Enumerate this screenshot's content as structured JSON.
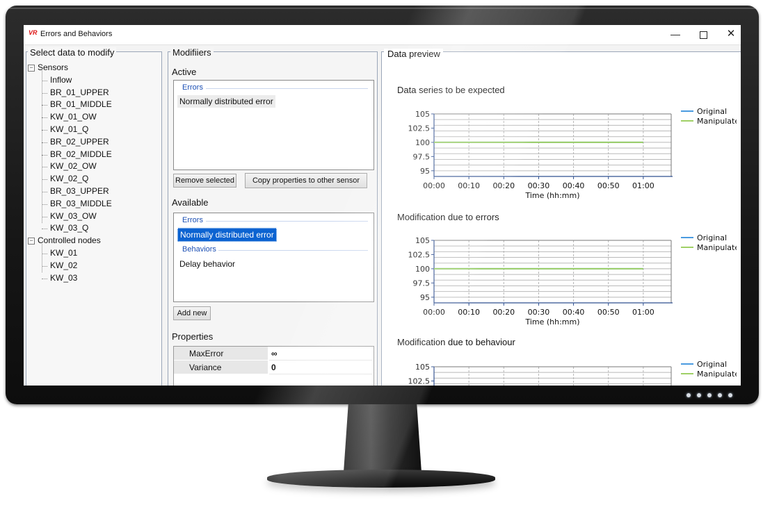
{
  "window": {
    "logo": "VR",
    "title": "Errors and Behaviors",
    "minimize_glyph": "—",
    "close_glyph": "✕"
  },
  "tree": {
    "title": "Select data to modify",
    "groups": [
      {
        "label": "Sensors",
        "expander": "−",
        "items": [
          "Inflow",
          "BR_01_UPPER",
          "BR_01_MIDDLE",
          "KW_01_OW",
          "KW_01_Q",
          "BR_02_UPPER",
          "BR_02_MIDDLE",
          "KW_02_OW",
          "KW_02_Q",
          "BR_03_UPPER",
          "BR_03_MIDDLE",
          "KW_03_OW",
          "KW_03_Q"
        ]
      },
      {
        "label": "Controlled nodes",
        "expander": "−",
        "items": [
          "KW_01",
          "KW_02",
          "KW_03"
        ]
      }
    ]
  },
  "modifiers": {
    "title": "Modifiiers",
    "active": {
      "heading": "Active",
      "errors_head": "Errors",
      "errors_items": [
        "Normally distributed error"
      ]
    },
    "remove_button": "Remove selected",
    "copy_button": "Copy properties to other sensor",
    "available": {
      "heading": "Available",
      "errors_head": "Errors",
      "errors_items": [
        "Normally distributed error"
      ],
      "behaviors_head": "Behaviors",
      "behaviors_items": [
        "Delay behavior"
      ]
    },
    "add_button": "Add new",
    "properties": {
      "heading": "Properties",
      "rows": [
        {
          "name": "MaxError",
          "value": "∞"
        },
        {
          "name": "Variance",
          "value": "0"
        }
      ]
    }
  },
  "preview": {
    "title": "Data preview"
  },
  "chart_data": [
    {
      "type": "line",
      "title": "Data series to be expected",
      "xlabel": "Time (hh:mm)",
      "ylabel": "",
      "x_ticks": [
        "00:00",
        "00:10",
        "00:20",
        "00:30",
        "00:40",
        "00:50",
        "01:00"
      ],
      "y_ticks": [
        "105",
        "102.5",
        "100",
        "97.5",
        "95"
      ],
      "xlim": [
        0,
        68
      ],
      "ylim": [
        94,
        105
      ],
      "grid": true,
      "legend": "right",
      "series": [
        {
          "name": "Original",
          "color": "#4a9be0",
          "x": [
            0,
            60
          ],
          "y": [
            100,
            100
          ]
        },
        {
          "name": "Manipulated",
          "color": "#9fd066",
          "x": [
            0,
            60
          ],
          "y": [
            100,
            100
          ]
        }
      ]
    },
    {
      "type": "line",
      "title": "Modification due to errors",
      "xlabel": "Time (hh:mm)",
      "ylabel": "",
      "x_ticks": [
        "00:00",
        "00:10",
        "00:20",
        "00:30",
        "00:40",
        "00:50",
        "01:00"
      ],
      "y_ticks": [
        "105",
        "102.5",
        "100",
        "97.5",
        "95"
      ],
      "xlim": [
        0,
        68
      ],
      "ylim": [
        94,
        105
      ],
      "grid": true,
      "legend": "right",
      "series": [
        {
          "name": "Original",
          "color": "#4a9be0",
          "x": [
            0,
            60
          ],
          "y": [
            100,
            100
          ]
        },
        {
          "name": "Manipulated",
          "color": "#9fd066",
          "x": [
            0,
            60
          ],
          "y": [
            100,
            100
          ]
        }
      ]
    },
    {
      "type": "line",
      "title": "Modification due to behaviour",
      "xlabel": "",
      "ylabel": "",
      "x_ticks": [],
      "y_ticks": [
        "105",
        "102.5"
      ],
      "xlim": [
        0,
        68
      ],
      "ylim": [
        94,
        105
      ],
      "grid": true,
      "legend": "right",
      "series": [
        {
          "name": "Original",
          "color": "#4a9be0",
          "x": [],
          "y": []
        },
        {
          "name": "Manipulated",
          "color": "#9fd066",
          "x": [],
          "y": []
        }
      ]
    }
  ]
}
